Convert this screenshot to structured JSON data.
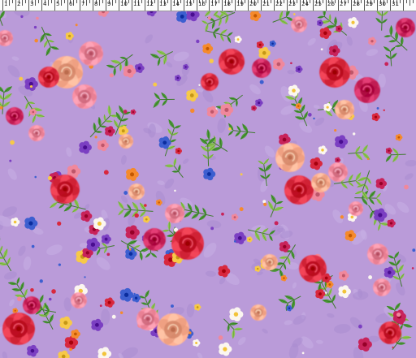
{
  "ruler": {
    "labels": [
      "1",
      "2",
      "3",
      "4",
      "5",
      "6",
      "7",
      "8",
      "9",
      "10",
      "11",
      "12",
      "13",
      "14",
      "15",
      "16",
      "17",
      "18",
      "19",
      "20",
      "21",
      "22",
      "23",
      "24",
      "25",
      "26",
      "27",
      "28",
      "29",
      "30",
      "31"
    ]
  },
  "fabric": {
    "background_color": "#ba9bd9",
    "palette": {
      "rose_red": "#d8283e",
      "rose_pink": "#f0889c",
      "rose_peach": "#f7a88a",
      "rose_magenta": "#c8235a",
      "bloom_blue": "#3d5fd0",
      "bloom_violet": "#7b3fc2",
      "bloom_yellow": "#f7c948",
      "bloom_white": "#fbf6f0",
      "bloom_orange": "#f58a2c",
      "leaf_green": "#4f9a3c",
      "leaf_light": "#8cc653"
    }
  }
}
